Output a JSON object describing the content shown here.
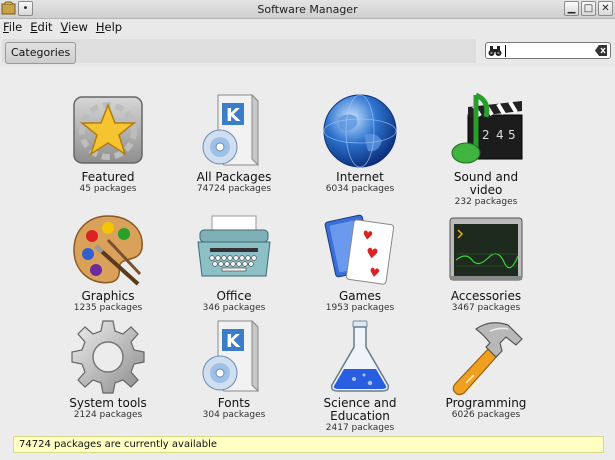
{
  "window": {
    "title": "Software Manager"
  },
  "menu": [
    {
      "label": "File",
      "mnemonic": "F"
    },
    {
      "label": "Edit",
      "mnemonic": "E"
    },
    {
      "label": "View",
      "mnemonic": "V"
    },
    {
      "label": "Help",
      "mnemonic": "H"
    }
  ],
  "toolbar": {
    "categories_label": "Categories"
  },
  "search": {
    "value": "",
    "placeholder": ""
  },
  "categories": [
    {
      "label": "Featured",
      "count": "45 packages",
      "icon": "star-icon"
    },
    {
      "label": "All Packages",
      "count": "74724 packages",
      "icon": "package-box-icon"
    },
    {
      "label": "Internet",
      "count": "6034 packages",
      "icon": "globe-icon"
    },
    {
      "label": "Sound and video",
      "count": "232 packages",
      "icon": "music-clapper-icon"
    },
    {
      "label": "Graphics",
      "count": "1235 packages",
      "icon": "palette-icon"
    },
    {
      "label": "Office",
      "count": "346 packages",
      "icon": "typewriter-icon"
    },
    {
      "label": "Games",
      "count": "1953 packages",
      "icon": "playing-cards-icon"
    },
    {
      "label": "Accessories",
      "count": "3467 packages",
      "icon": "terminal-icon"
    },
    {
      "label": "System tools",
      "count": "2124 packages",
      "icon": "gear-icon"
    },
    {
      "label": "Fonts",
      "count": "304 packages",
      "icon": "package-box-icon"
    },
    {
      "label": "Science and Education",
      "count": "2417 packages",
      "icon": "flask-icon"
    },
    {
      "label": "Programming",
      "count": "6026 packages",
      "icon": "hammer-icon"
    }
  ],
  "status": {
    "text": "74724 packages are currently available",
    "background": "#ffffc4"
  }
}
